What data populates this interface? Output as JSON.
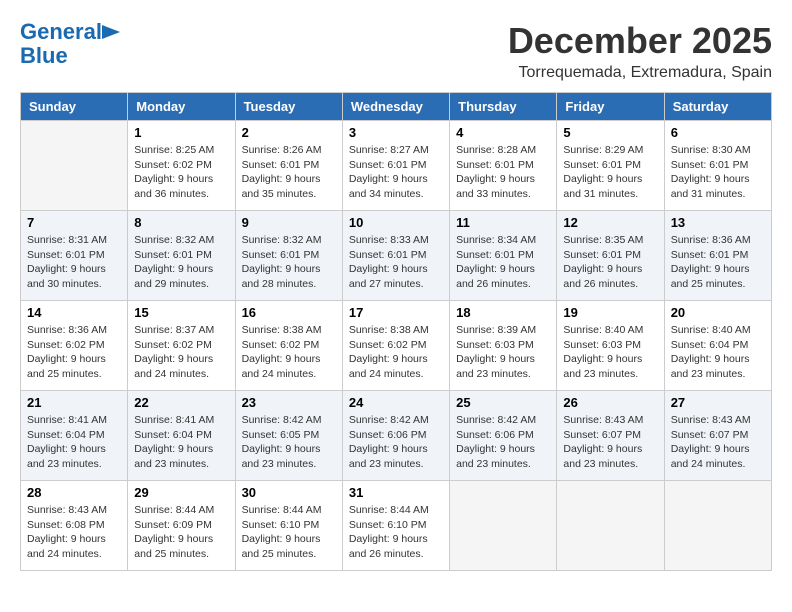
{
  "logo": {
    "line1": "General",
    "line2": "Blue"
  },
  "title": "December 2025",
  "subtitle": "Torrequemada, Extremadura, Spain",
  "headers": [
    "Sunday",
    "Monday",
    "Tuesday",
    "Wednesday",
    "Thursday",
    "Friday",
    "Saturday"
  ],
  "weeks": [
    [
      {
        "day": "",
        "info": ""
      },
      {
        "day": "1",
        "info": "Sunrise: 8:25 AM\nSunset: 6:02 PM\nDaylight: 9 hours\nand 36 minutes."
      },
      {
        "day": "2",
        "info": "Sunrise: 8:26 AM\nSunset: 6:01 PM\nDaylight: 9 hours\nand 35 minutes."
      },
      {
        "day": "3",
        "info": "Sunrise: 8:27 AM\nSunset: 6:01 PM\nDaylight: 9 hours\nand 34 minutes."
      },
      {
        "day": "4",
        "info": "Sunrise: 8:28 AM\nSunset: 6:01 PM\nDaylight: 9 hours\nand 33 minutes."
      },
      {
        "day": "5",
        "info": "Sunrise: 8:29 AM\nSunset: 6:01 PM\nDaylight: 9 hours\nand 31 minutes."
      },
      {
        "day": "6",
        "info": "Sunrise: 8:30 AM\nSunset: 6:01 PM\nDaylight: 9 hours\nand 31 minutes."
      }
    ],
    [
      {
        "day": "7",
        "info": "Sunrise: 8:31 AM\nSunset: 6:01 PM\nDaylight: 9 hours\nand 30 minutes."
      },
      {
        "day": "8",
        "info": "Sunrise: 8:32 AM\nSunset: 6:01 PM\nDaylight: 9 hours\nand 29 minutes."
      },
      {
        "day": "9",
        "info": "Sunrise: 8:32 AM\nSunset: 6:01 PM\nDaylight: 9 hours\nand 28 minutes."
      },
      {
        "day": "10",
        "info": "Sunrise: 8:33 AM\nSunset: 6:01 PM\nDaylight: 9 hours\nand 27 minutes."
      },
      {
        "day": "11",
        "info": "Sunrise: 8:34 AM\nSunset: 6:01 PM\nDaylight: 9 hours\nand 26 minutes."
      },
      {
        "day": "12",
        "info": "Sunrise: 8:35 AM\nSunset: 6:01 PM\nDaylight: 9 hours\nand 26 minutes."
      },
      {
        "day": "13",
        "info": "Sunrise: 8:36 AM\nSunset: 6:01 PM\nDaylight: 9 hours\nand 25 minutes."
      }
    ],
    [
      {
        "day": "14",
        "info": "Sunrise: 8:36 AM\nSunset: 6:02 PM\nDaylight: 9 hours\nand 25 minutes."
      },
      {
        "day": "15",
        "info": "Sunrise: 8:37 AM\nSunset: 6:02 PM\nDaylight: 9 hours\nand 24 minutes."
      },
      {
        "day": "16",
        "info": "Sunrise: 8:38 AM\nSunset: 6:02 PM\nDaylight: 9 hours\nand 24 minutes."
      },
      {
        "day": "17",
        "info": "Sunrise: 8:38 AM\nSunset: 6:02 PM\nDaylight: 9 hours\nand 24 minutes."
      },
      {
        "day": "18",
        "info": "Sunrise: 8:39 AM\nSunset: 6:03 PM\nDaylight: 9 hours\nand 23 minutes."
      },
      {
        "day": "19",
        "info": "Sunrise: 8:40 AM\nSunset: 6:03 PM\nDaylight: 9 hours\nand 23 minutes."
      },
      {
        "day": "20",
        "info": "Sunrise: 8:40 AM\nSunset: 6:04 PM\nDaylight: 9 hours\nand 23 minutes."
      }
    ],
    [
      {
        "day": "21",
        "info": "Sunrise: 8:41 AM\nSunset: 6:04 PM\nDaylight: 9 hours\nand 23 minutes."
      },
      {
        "day": "22",
        "info": "Sunrise: 8:41 AM\nSunset: 6:04 PM\nDaylight: 9 hours\nand 23 minutes."
      },
      {
        "day": "23",
        "info": "Sunrise: 8:42 AM\nSunset: 6:05 PM\nDaylight: 9 hours\nand 23 minutes."
      },
      {
        "day": "24",
        "info": "Sunrise: 8:42 AM\nSunset: 6:06 PM\nDaylight: 9 hours\nand 23 minutes."
      },
      {
        "day": "25",
        "info": "Sunrise: 8:42 AM\nSunset: 6:06 PM\nDaylight: 9 hours\nand 23 minutes."
      },
      {
        "day": "26",
        "info": "Sunrise: 8:43 AM\nSunset: 6:07 PM\nDaylight: 9 hours\nand 23 minutes."
      },
      {
        "day": "27",
        "info": "Sunrise: 8:43 AM\nSunset: 6:07 PM\nDaylight: 9 hours\nand 24 minutes."
      }
    ],
    [
      {
        "day": "28",
        "info": "Sunrise: 8:43 AM\nSunset: 6:08 PM\nDaylight: 9 hours\nand 24 minutes."
      },
      {
        "day": "29",
        "info": "Sunrise: 8:44 AM\nSunset: 6:09 PM\nDaylight: 9 hours\nand 25 minutes."
      },
      {
        "day": "30",
        "info": "Sunrise: 8:44 AM\nSunset: 6:10 PM\nDaylight: 9 hours\nand 25 minutes."
      },
      {
        "day": "31",
        "info": "Sunrise: 8:44 AM\nSunset: 6:10 PM\nDaylight: 9 hours\nand 26 minutes."
      },
      {
        "day": "",
        "info": ""
      },
      {
        "day": "",
        "info": ""
      },
      {
        "day": "",
        "info": ""
      }
    ]
  ]
}
